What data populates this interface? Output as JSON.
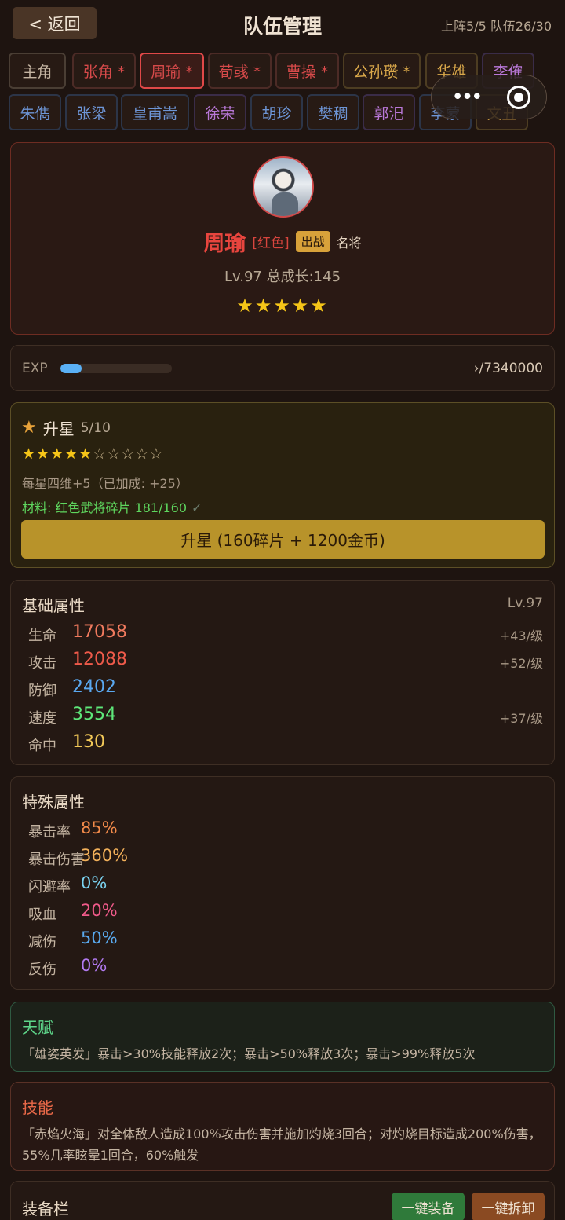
{
  "header": {
    "back_label": "< 返回",
    "title": "队伍管理",
    "team_info": "上阵5/5 队伍26/30"
  },
  "tabs_row1": [
    {
      "label": "主角",
      "color": "gray"
    },
    {
      "label": "张角 *",
      "color": "red"
    },
    {
      "label": "周瑜 *",
      "color": "red",
      "active": true
    },
    {
      "label": "荀彧 *",
      "color": "red"
    },
    {
      "label": "曹操 *",
      "color": "red"
    },
    {
      "label": "公孙瓒 *",
      "color": "gold"
    },
    {
      "label": "华雄",
      "color": "gold"
    },
    {
      "label": "李傕",
      "color": "purple"
    }
  ],
  "tabs_row2": [
    {
      "label": "朱儁",
      "color": "blue"
    },
    {
      "label": "张梁",
      "color": "blue"
    },
    {
      "label": "皇甫嵩",
      "color": "blue"
    },
    {
      "label": "徐荣",
      "color": "purple"
    },
    {
      "label": "胡珍",
      "color": "blue"
    },
    {
      "label": "樊稠",
      "color": "blue"
    },
    {
      "label": "郭汜",
      "color": "purple"
    },
    {
      "label": "李蒙",
      "color": "blue"
    },
    {
      "label": "文丑",
      "color": "gold"
    }
  ],
  "capsule": {
    "more_label": "•••"
  },
  "hero": {
    "name": "周瑜",
    "rarity": "[红色]",
    "deploy_badge": "出战",
    "tag": "名将",
    "level_text": "Lv.97 总成长:145",
    "stars": "★★★★★"
  },
  "exp": {
    "label": "EXP",
    "progress": 0.19,
    "value_text": "›/7340000"
  },
  "star_up": {
    "title": "升星",
    "progress": "5/10",
    "filled_stars": "★★★★★",
    "empty_stars": "☆☆☆☆☆",
    "bonus_text": "每星四维+5（已加成: +25）",
    "material_text": "材料: 红色武将碎片 181/160",
    "check": "✓",
    "button_label": "升星 (160碎片 + 1200金币)"
  },
  "base_stats": {
    "title": "基础属性",
    "level": "Lv.97",
    "rows": [
      {
        "label": "生命",
        "value": "17058",
        "growth": "+43/级",
        "color": "#f07a5e"
      },
      {
        "label": "攻击",
        "value": "12088",
        "growth": "+52/级",
        "color": "#ef5a4a"
      },
      {
        "label": "防御",
        "value": "2402",
        "growth": "",
        "color": "#5aa8f0"
      },
      {
        "label": "速度",
        "value": "3554",
        "growth": "+37/级",
        "color": "#5ee87a"
      },
      {
        "label": "命中",
        "value": "130",
        "growth": "",
        "color": "#f2c858"
      }
    ]
  },
  "special_stats": {
    "title": "特殊属性",
    "rows": [
      {
        "label": "暴击率",
        "value": "85%",
        "color": "#f28a4a"
      },
      {
        "label": "暴击伤害",
        "value": "360%",
        "color": "#f2b05a"
      },
      {
        "label": "闪避率",
        "value": "0%",
        "color": "#7ad2f0"
      },
      {
        "label": "吸血",
        "value": "20%",
        "color": "#f05a8a"
      },
      {
        "label": "减伤",
        "value": "50%",
        "color": "#5aaaf0"
      },
      {
        "label": "反伤",
        "value": "0%",
        "color": "#b27af0"
      }
    ]
  },
  "talent": {
    "title": "天赋",
    "desc": "「雄姿英发」暴击>30%技能释放2次；暴击>50%释放3次；暴击>99%释放5次"
  },
  "skill": {
    "title": "技能",
    "desc": "「赤焰火海」对全体敌人造成100%攻击伤害并施加灼烧3回合；对灼烧目标造成200%伤害，55%几率眩晕1回合，60%触发"
  },
  "equipment": {
    "title": "装备栏",
    "equip_all": "一键装备",
    "unequip_all": "一键拆卸"
  }
}
